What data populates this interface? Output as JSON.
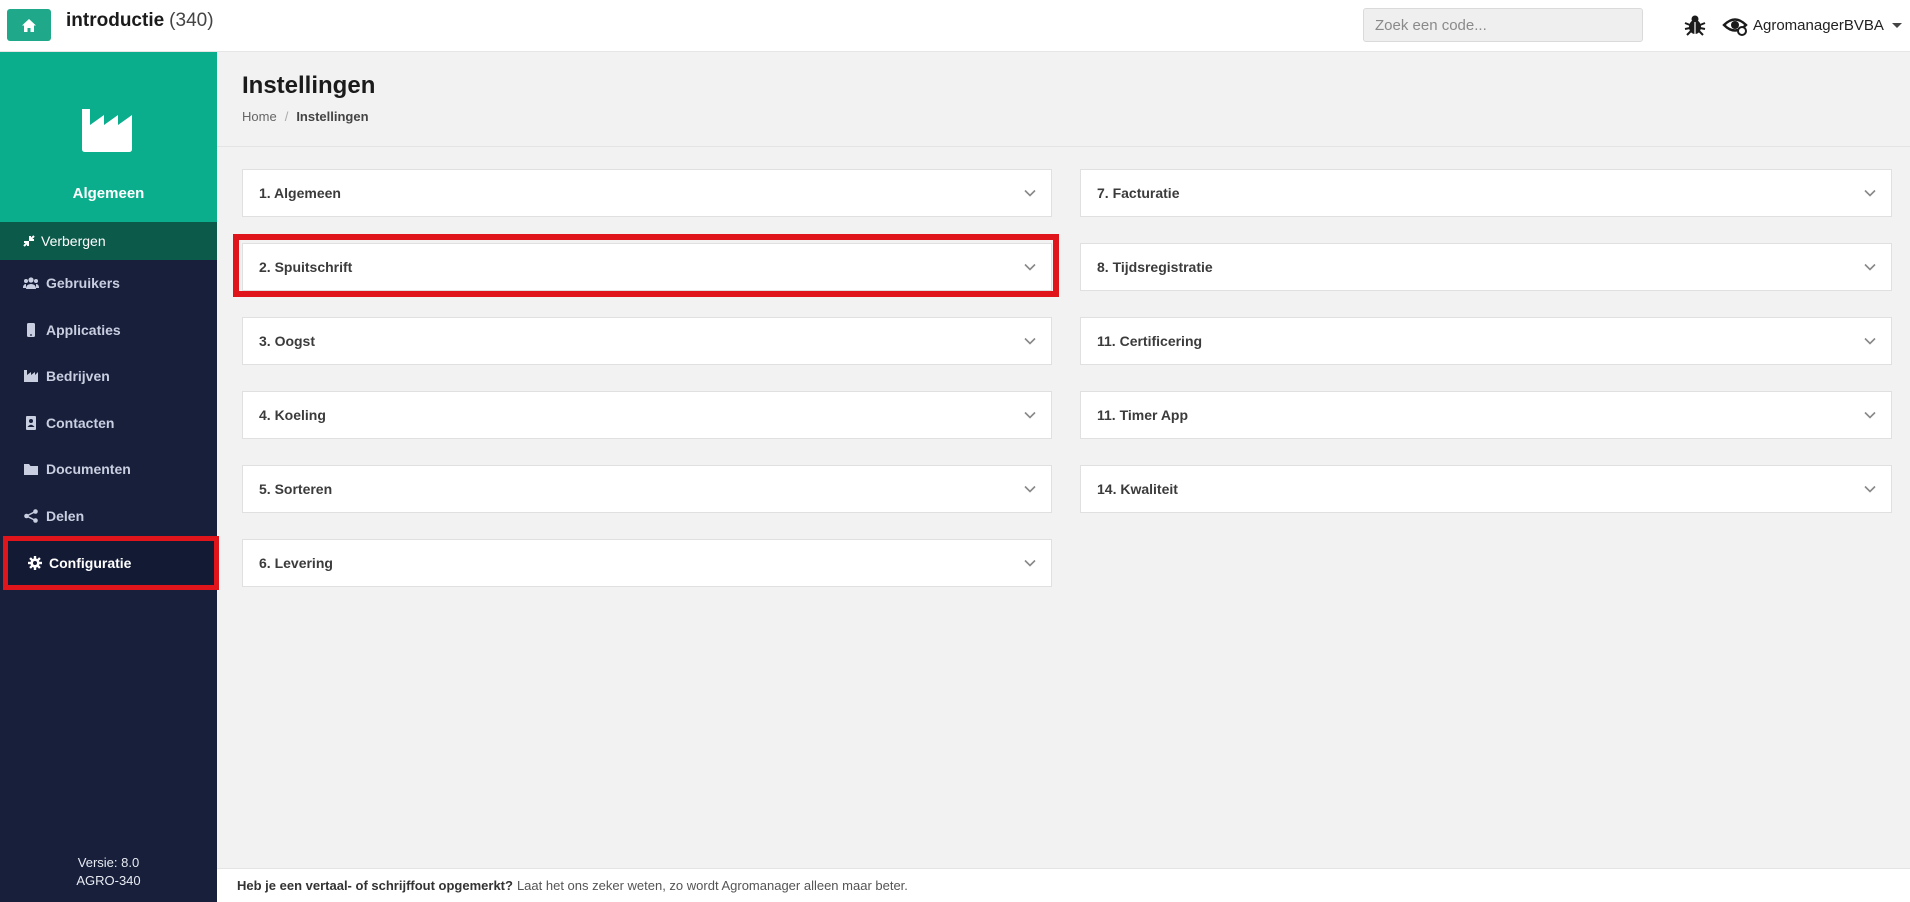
{
  "topbar": {
    "title": "introductie",
    "count": "(340)",
    "search_placeholder": "Zoek een code...",
    "user_name": "AgromanagerBVBA"
  },
  "sidebar": {
    "header_title": "Algemeen",
    "hide_label": "Verbergen",
    "items": [
      {
        "label": "Gebruikers",
        "icon": "users-icon"
      },
      {
        "label": "Applicaties",
        "icon": "mobile-icon"
      },
      {
        "label": "Bedrijven",
        "icon": "industry-icon"
      },
      {
        "label": "Contacten",
        "icon": "address-book-icon"
      },
      {
        "label": "Documenten",
        "icon": "folder-icon"
      },
      {
        "label": "Delen",
        "icon": "share-icon"
      }
    ],
    "config_label": "Configuratie",
    "version_line1": "Versie: 8.0",
    "version_line2": "AGRO-340"
  },
  "page": {
    "title": "Instellingen",
    "breadcrumb_home": "Home",
    "breadcrumb_separator": "/",
    "breadcrumb_current": "Instellingen"
  },
  "panels_left": [
    "1. Algemeen",
    "2. Spuitschrift",
    "3. Oogst",
    "4. Koeling",
    "5. Sorteren",
    "6. Levering"
  ],
  "panels_right": [
    "7. Facturatie",
    "8. Tijdsregistratie",
    "11. Certificering",
    "11. Timer App",
    "14. Kwaliteit"
  ],
  "footer": {
    "bold": "Heb je een vertaal- of schrijffout opgemerkt?",
    "text": "Laat het ons zeker weten, zo wordt Agromanager alleen maar beter."
  },
  "colors": {
    "accent": "#0aad8c",
    "sidebar": "#171f3b",
    "highlight": "#e0141b"
  }
}
